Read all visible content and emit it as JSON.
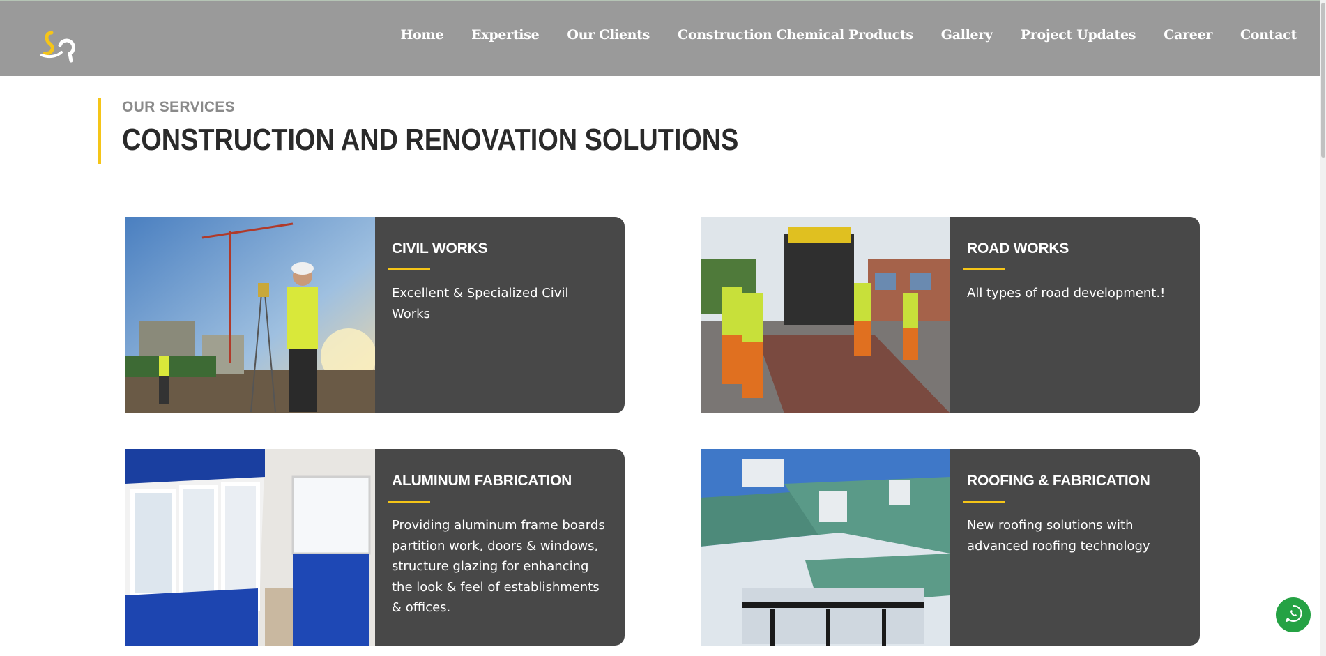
{
  "header": {
    "logo_alt": "SA",
    "nav": [
      "Home",
      "Expertise",
      "Our Clients",
      "Construction Chemical Products",
      "Gallery",
      "Project Updates",
      "Career",
      "Contact"
    ]
  },
  "services": {
    "kicker": "OUR SERVICES",
    "title": "CONSTRUCTION AND RENOVATION SOLUTIONS",
    "cards": [
      {
        "title": "CIVIL WORKS",
        "description": "Excellent & Specialized Civil Works",
        "image": "engineer-with-crane-photo"
      },
      {
        "title": "ROAD WORKS",
        "description": "All types of road development.!",
        "image": "road-paving-crew-photo"
      },
      {
        "title": "ALUMINUM FABRICATION",
        "description": "Providing aluminum frame boards partition work, doors & windows, structure glazing for enhancing the look & feel of establishments & offices.",
        "image": "aluminum-partition-office-photo"
      },
      {
        "title": "ROOFING & FABRICATION",
        "description": "New roofing solutions with advanced roofing technology",
        "image": "metal-roofs-photo"
      }
    ]
  },
  "colors": {
    "header_bg": "#9a9a9a",
    "accent": "#f5c518",
    "card_bg": "#484848",
    "whatsapp": "#25a244"
  },
  "floating": {
    "icon": "whatsapp-icon"
  }
}
